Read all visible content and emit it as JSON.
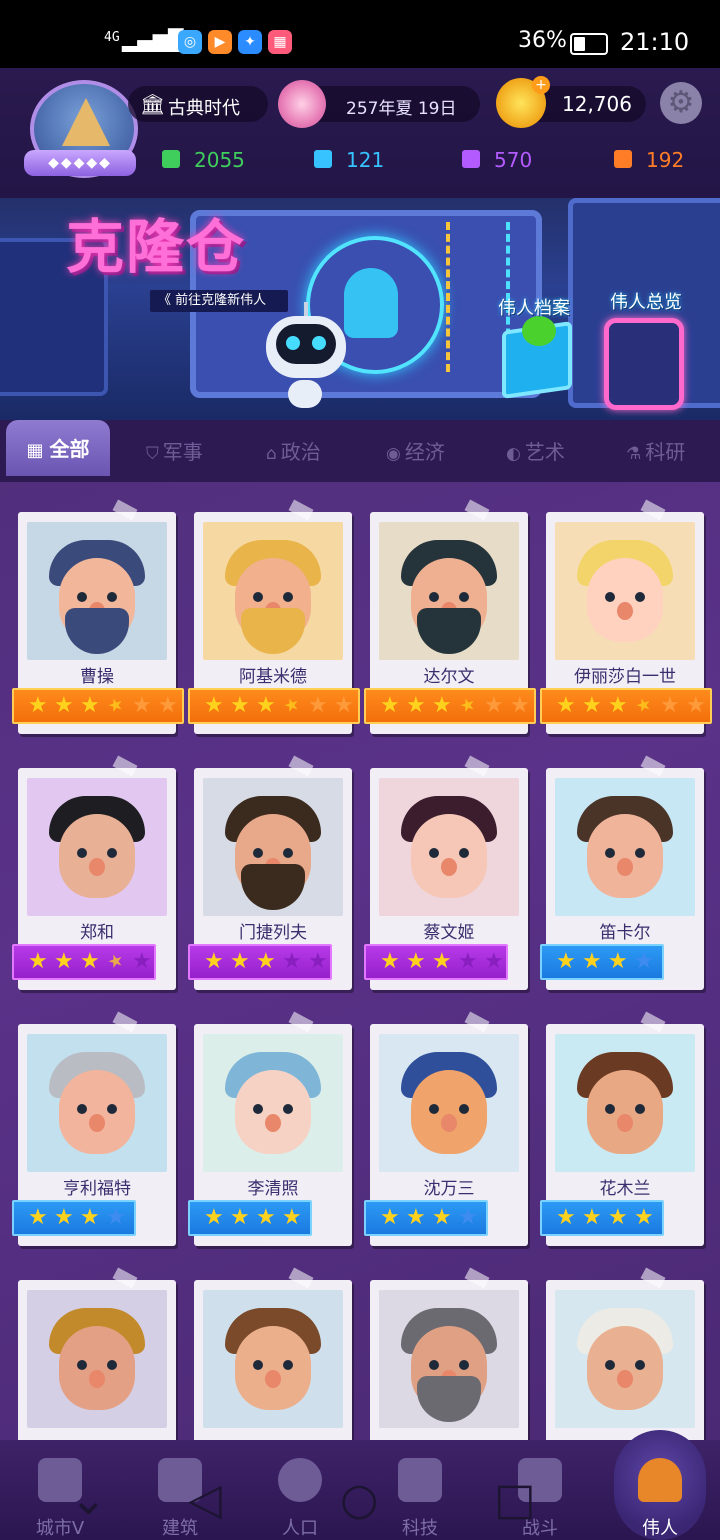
{
  "status_bar": {
    "signal": "4G",
    "battery_text": "36%",
    "battery_level": 0.36,
    "time": "21:10"
  },
  "top_bar": {
    "era": "古典时代",
    "date": "257年夏 19日",
    "coins": "12,706"
  },
  "resources": [
    {
      "icon": "green-crate-icon",
      "value": "2055",
      "color": "#3fce5b"
    },
    {
      "icon": "blue-crate-icon",
      "value": "121",
      "color": "#37c3ff"
    },
    {
      "icon": "purple-crate-icon",
      "value": "570",
      "color": "#b35bff"
    },
    {
      "icon": "orange-crate-icon",
      "value": "192",
      "color": "#ff7d27"
    }
  ],
  "banner": {
    "title": "克隆仓",
    "subtitle": "《 前往克隆新伟人",
    "archive_label": "伟人档案",
    "overview_label": "伟人总览"
  },
  "tabs": [
    {
      "label": "全部",
      "icon": "grid-icon",
      "active": true
    },
    {
      "label": "军事",
      "icon": "shield-icon",
      "active": false
    },
    {
      "label": "政治",
      "icon": "temple-icon",
      "active": false
    },
    {
      "label": "经济",
      "icon": "coins-icon",
      "active": false
    },
    {
      "label": "艺术",
      "icon": "palette-icon",
      "active": false
    },
    {
      "label": "科研",
      "icon": "flask-icon",
      "active": false
    }
  ],
  "characters": [
    {
      "name": "曹操",
      "stars": 3.5,
      "max_stars": 6,
      "tier": "orange"
    },
    {
      "name": "阿基米德",
      "stars": 3.5,
      "max_stars": 6,
      "tier": "orange"
    },
    {
      "name": "达尔文",
      "stars": 3.5,
      "max_stars": 6,
      "tier": "orange"
    },
    {
      "name": "伊丽莎白一世",
      "stars": 3.5,
      "max_stars": 6,
      "tier": "orange"
    },
    {
      "name": "郑和",
      "stars": 3.5,
      "max_stars": 5,
      "tier": "purple"
    },
    {
      "name": "门捷列夫",
      "stars": 3,
      "max_stars": 5,
      "tier": "purple"
    },
    {
      "name": "蔡文姬",
      "stars": 3,
      "max_stars": 5,
      "tier": "purple"
    },
    {
      "name": "笛卡尔",
      "stars": 3,
      "max_stars": 4,
      "tier": "blue"
    },
    {
      "name": "亨利福特",
      "stars": 3,
      "max_stars": 4,
      "tier": "blue"
    },
    {
      "name": "李清照",
      "stars": 4,
      "max_stars": 4,
      "tier": "blue"
    },
    {
      "name": "沈万三",
      "stars": 3,
      "max_stars": 4,
      "tier": "blue"
    },
    {
      "name": "花木兰",
      "stars": 4,
      "max_stars": 4,
      "tier": "blue"
    },
    {
      "name": "",
      "stars": 0,
      "max_stars": 0,
      "tier": "none"
    },
    {
      "name": "",
      "stars": 0,
      "max_stars": 0,
      "tier": "none"
    },
    {
      "name": "",
      "stars": 0,
      "max_stars": 0,
      "tier": "none"
    },
    {
      "name": "",
      "stars": 0,
      "max_stars": 0,
      "tier": "none"
    }
  ],
  "bottom_nav": [
    {
      "label": "城市V",
      "icon": "castle-icon",
      "active": false
    },
    {
      "label": "建筑",
      "icon": "house-icon",
      "active": false
    },
    {
      "label": "人口",
      "icon": "person-icon",
      "active": false
    },
    {
      "label": "科技",
      "icon": "book-icon",
      "active": false
    },
    {
      "label": "战斗",
      "icon": "swords-icon",
      "active": false
    },
    {
      "label": "伟人",
      "icon": "bust-icon",
      "active": true
    }
  ]
}
